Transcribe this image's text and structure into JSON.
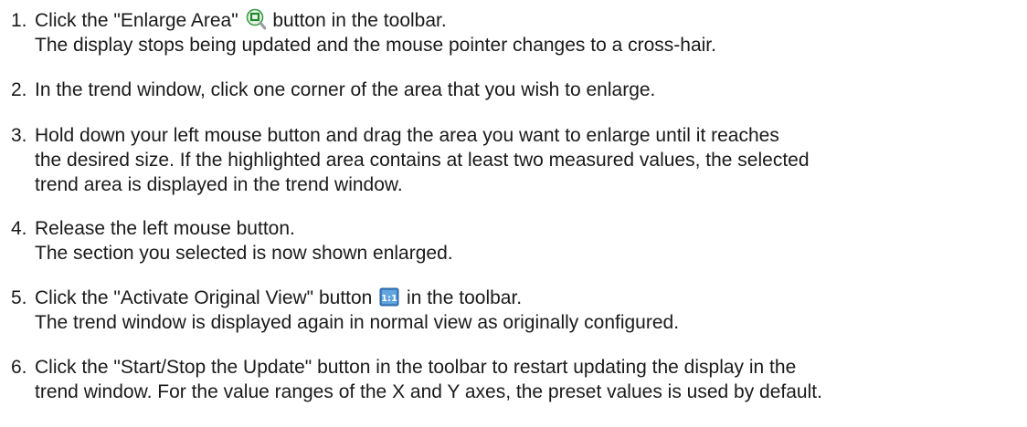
{
  "steps": [
    {
      "number": "1.",
      "line1_before": "Click the \"Enlarge Area\"",
      "icon": "enlarge-area-icon",
      "line1_after": "button in the toolbar.",
      "line2": "The display stops being updated and the mouse pointer changes to a cross-hair."
    },
    {
      "number": "2.",
      "line1": "In the trend window, click one corner of the area that you wish to enlarge."
    },
    {
      "number": "3.",
      "line1": "Hold down your left mouse button and drag the area you want to enlarge until it reaches",
      "line2": "the desired size. If the highlighted area contains at least two measured values, the selected",
      "line3": "trend area is displayed in the trend window."
    },
    {
      "number": "4.",
      "line1": "Release the left mouse button.",
      "line2": "The section you selected is now shown enlarged."
    },
    {
      "number": "5.",
      "line1_before": "Click the \"Activate Original View\" button",
      "icon": "original-view-icon",
      "line1_after": "in the toolbar.",
      "line2": "The trend window is displayed again in normal view as originally configured."
    },
    {
      "number": "6.",
      "line1": "Click the \"Start/Stop the Update\" button in the toolbar to restart updating the display in the",
      "line2": "trend window. For the value ranges of the X and Y axes, the preset values is used by default."
    }
  ],
  "colors": {
    "text": "#1a1a1a",
    "enlarge_icon_green": "#2e9a3a",
    "original_icon_blue": "#3a82c8"
  }
}
